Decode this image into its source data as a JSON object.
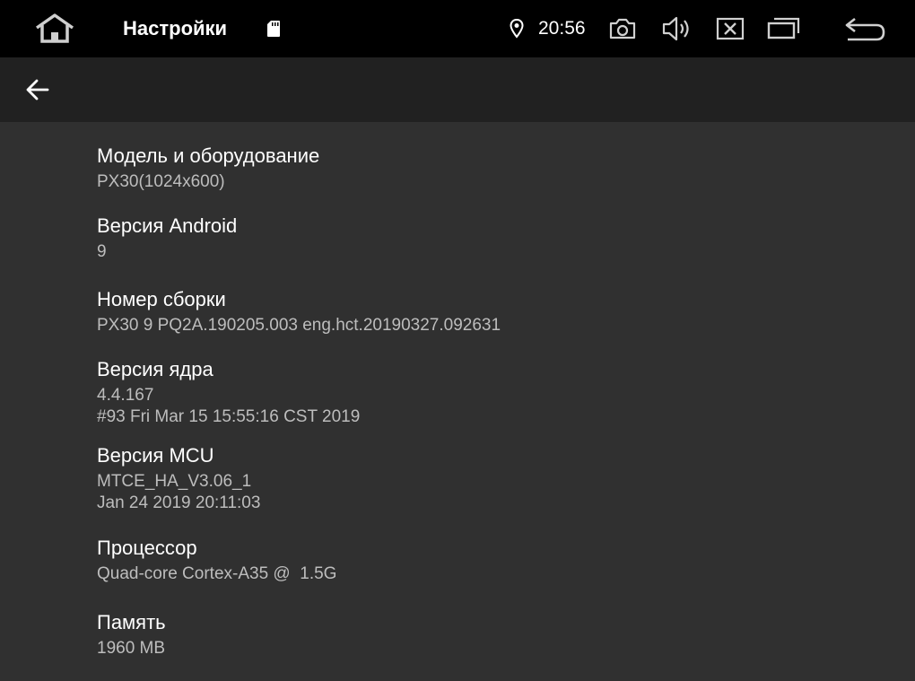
{
  "status_bar": {
    "title": "Настройки",
    "time": "20:56",
    "icons": {
      "home": "home-icon",
      "sd_card": "sd-card-icon",
      "location": "location-pin-icon",
      "screenshot": "camera-icon",
      "volume": "volume-icon",
      "close_app": "close-box-icon",
      "recents": "recent-apps-icon",
      "back": "return-icon"
    }
  },
  "toolbar": {
    "back_icon": "arrow-left-icon"
  },
  "preferences": [
    {
      "title": "Модель и оборудование",
      "summary": "PX30(1024x600)"
    },
    {
      "title": "Версия Android",
      "summary": "9"
    },
    {
      "title": "Номер сборки",
      "summary": "PX30 9 PQ2A.190205.003 eng.hct.20190327.092631"
    },
    {
      "title": "Версия ядра",
      "summary": "4.4.167\n#93 Fri Mar 15 15:55:16 CST 2019"
    },
    {
      "title": "Версия MCU",
      "summary": "MTCE_HA_V3.06_1\nJan 24 2019 20:11:03"
    },
    {
      "title": "Процессор",
      "summary": "Quad-core Cortex-A35 @  1.5G"
    },
    {
      "title": "Память",
      "summary": "1960 MB"
    }
  ],
  "colors": {
    "status_bar_bg": "#000000",
    "toolbar_bg": "#212121",
    "content_bg": "#303030",
    "title_text": "#ffffff",
    "summary_text": "#bdbdbd"
  }
}
